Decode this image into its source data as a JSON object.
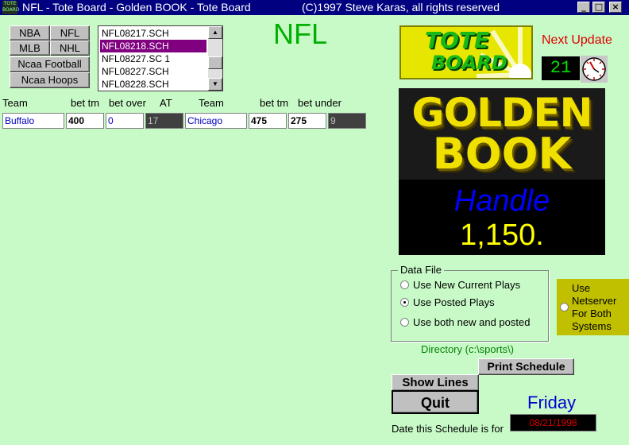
{
  "window": {
    "title": "NFL - Tote Board - Golden BOOK - Tote Board",
    "copyright": "(C)1997 Steve Karas, all rights reserved",
    "icon_text": "TOTE BOARD",
    "minimize_glyph": "_",
    "maximize_glyph": "□",
    "close_glyph": "×"
  },
  "sports": {
    "nba": "NBA",
    "nfl": "NFL",
    "mlb": "MLB",
    "nhl": "NHL",
    "ncaa_football": "Ncaa Football",
    "ncaa_hoops": "Ncaa Hoops"
  },
  "file_list": {
    "items": [
      "NFL08217.SCH",
      "NFL08218.SCH",
      "NFL08227.SC 1",
      "NFL08227.SCH",
      "NFL08228.SCH"
    ],
    "selected": "NFL08218.SCH",
    "scroll_up_glyph": "▲",
    "scroll_down_glyph": "▼"
  },
  "sport_title": "NFL",
  "columns": {
    "team": "Team",
    "bet_tm": "bet tm",
    "bet_over": "bet over",
    "at": "AT",
    "team2": "Team",
    "bet_tm2": "bet tm",
    "bet_under": "bet under"
  },
  "game_row": {
    "team1": "Buffalo",
    "bet_tm1": "400",
    "bet_over": "0",
    "at": "17",
    "team2": "Chicago",
    "bet_tm2": "475",
    "bet_under": "275",
    "extra": "9"
  },
  "tote_logo": {
    "line1": "TOTE",
    "line2": "BOARD"
  },
  "next_update": {
    "label": "Next Update",
    "value": "21"
  },
  "golden_book": {
    "line1": "GOLDEN",
    "line2": "BOOK",
    "handle_label": "Handle",
    "handle_value": "1,150."
  },
  "data_file": {
    "legend": "Data File",
    "options": [
      "Use New Current Plays",
      "Use Posted Plays",
      "Use both  new and posted"
    ],
    "selected_index": 1
  },
  "netserver": {
    "label": "Use Netserver For Both Systems",
    "checked": false
  },
  "directory": "Directory (c:\\sports\\)",
  "buttons": {
    "print_schedule": "Print Schedule",
    "show_lines": "Show Lines",
    "quit": "Quit"
  },
  "schedule": {
    "day": "Friday",
    "date": "08/21/1998",
    "date_label": "Date this Schedule is for"
  },
  "colors": {
    "background": "#c8fac8",
    "titlebar": "#000080",
    "selection": "#800080",
    "sport_title": "#00b000",
    "next_update": "#e00000",
    "handle": "#0000ff",
    "handle_value": "#ffff00",
    "golden": "#f0e000",
    "netserver": "#c0c000"
  }
}
